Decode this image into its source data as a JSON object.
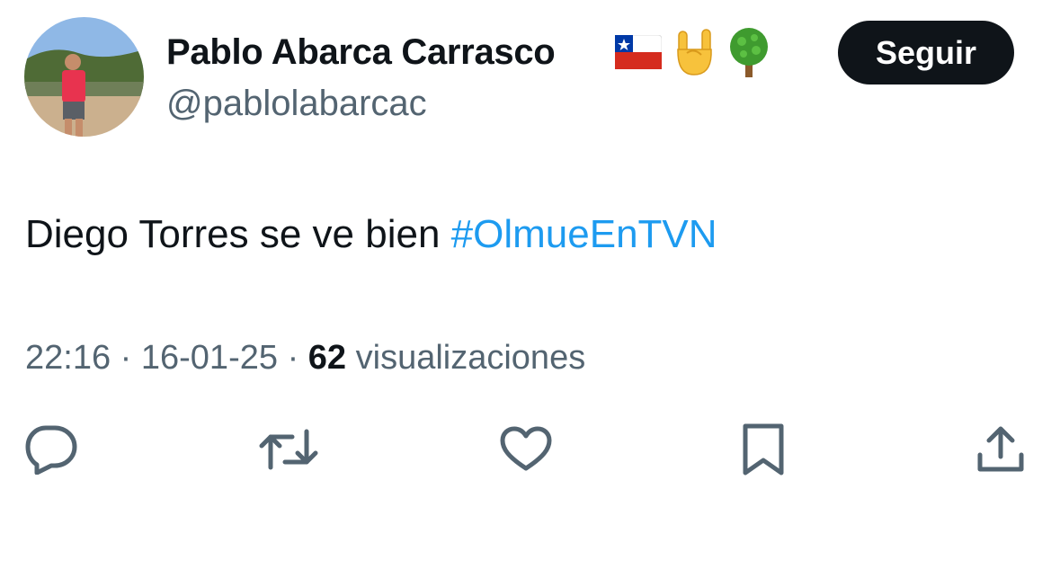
{
  "author": {
    "name": "Pablo Abarca Carrasco",
    "handle": "@pablolabarcac",
    "name_emojis": [
      "chile-flag-icon",
      "rock-hand-icon",
      "tree-icon"
    ]
  },
  "follow_button": {
    "label": "Seguir"
  },
  "tweet": {
    "text": "Diego Torres se ve bien ",
    "hashtag": "#OlmueEnTVN"
  },
  "meta": {
    "time": "22:16",
    "separator": "·",
    "date": "16-01-25",
    "views_count": "62",
    "views_label": "visualizaciones"
  },
  "actions": [
    "reply-icon",
    "retweet-icon",
    "like-icon",
    "bookmark-icon",
    "share-icon"
  ],
  "colors": {
    "text": "#0f1419",
    "secondary": "#536471",
    "accent": "#1d9bf0",
    "button_bg": "#0f1419"
  }
}
